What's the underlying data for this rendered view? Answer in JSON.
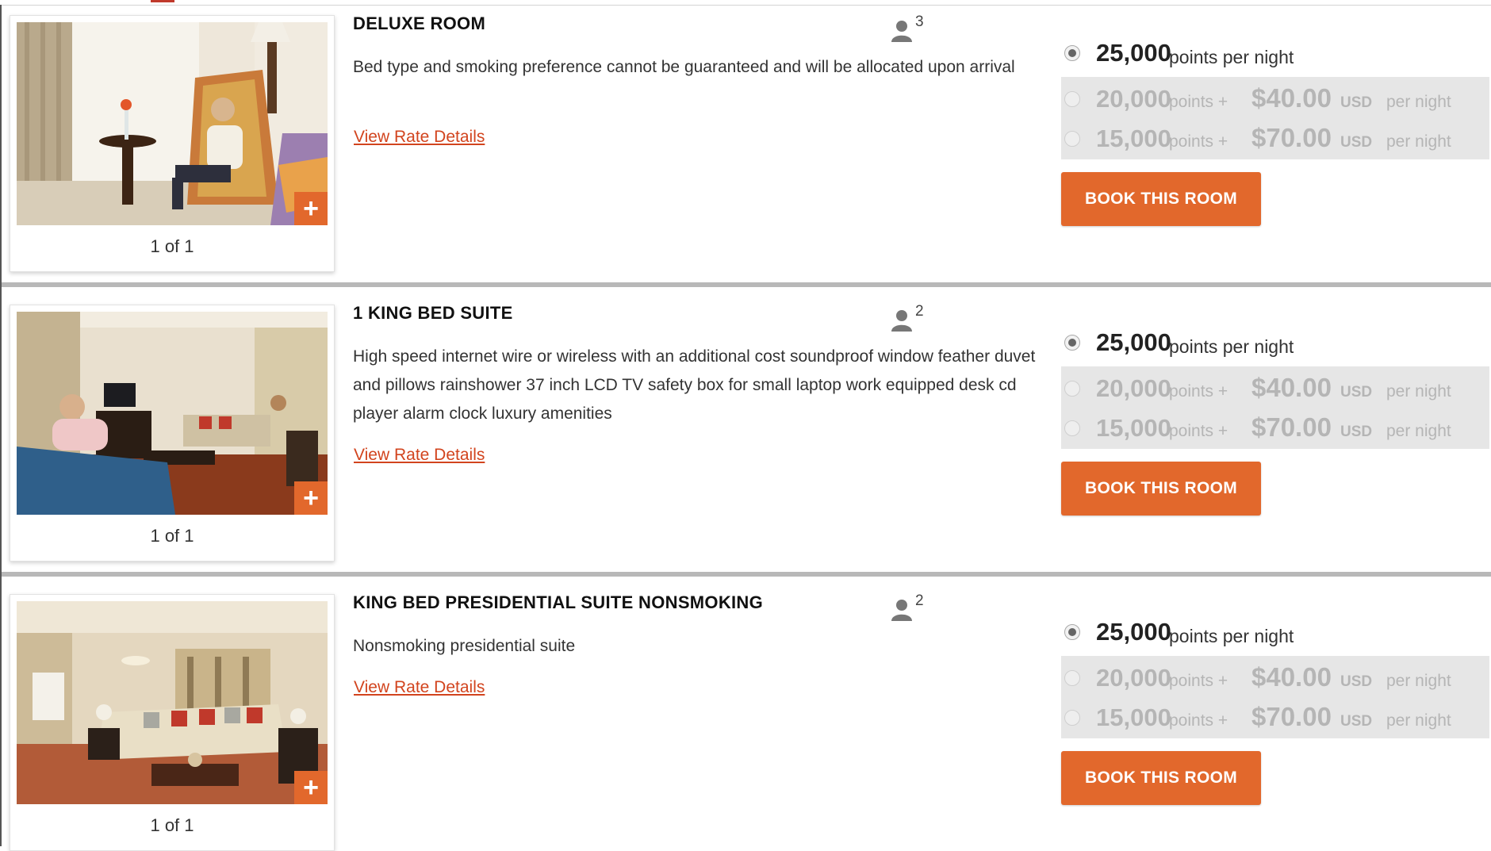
{
  "colors": {
    "accent": "#e2682c",
    "link": "#d2441e",
    "alt_rates_bg": "#e6e6e6",
    "divider": "#b8b8b8"
  },
  "rooms": [
    {
      "title": "DELUXE ROOM",
      "occupancy": "3",
      "description": "Bed type and smoking preference cannot be guaranteed and will be allocated upon arrival",
      "rate_link": "View Rate Details",
      "photo_counter": "1 of 1",
      "photo_button": "+",
      "main_rate": {
        "points": "25,000",
        "suffix": "points per night",
        "selected": true
      },
      "alt_rates": [
        {
          "points": "20,000",
          "points_label": "points +",
          "cash": "$40.00",
          "currency": "USD",
          "per": "per night"
        },
        {
          "points": "15,000",
          "points_label": "points +",
          "cash": "$70.00",
          "currency": "USD",
          "per": "per night"
        }
      ],
      "book_label": "BOOK THIS ROOM"
    },
    {
      "title": "1 KING BED SUITE",
      "occupancy": "2",
      "description": "High speed internet wire or wireless with an additional cost soundproof window feather duvet and pillows rainshower 37 inch LCD TV safety box for small laptop work equipped desk cd player alarm clock luxury amenities",
      "rate_link": "View Rate Details",
      "photo_counter": "1 of 1",
      "photo_button": "+",
      "main_rate": {
        "points": "25,000",
        "suffix": "points per night",
        "selected": true
      },
      "alt_rates": [
        {
          "points": "20,000",
          "points_label": "points +",
          "cash": "$40.00",
          "currency": "USD",
          "per": "per night"
        },
        {
          "points": "15,000",
          "points_label": "points +",
          "cash": "$70.00",
          "currency": "USD",
          "per": "per night"
        }
      ],
      "book_label": "BOOK THIS ROOM"
    },
    {
      "title": "KING BED PRESIDENTIAL SUITE NONSMOKING",
      "occupancy": "2",
      "description": "Nonsmoking presidential suite",
      "rate_link": "View Rate Details",
      "photo_counter": "1 of 1",
      "photo_button": "+",
      "main_rate": {
        "points": "25,000",
        "suffix": "points per night",
        "selected": true
      },
      "alt_rates": [
        {
          "points": "20,000",
          "points_label": "points +",
          "cash": "$40.00",
          "currency": "USD",
          "per": "per night"
        },
        {
          "points": "15,000",
          "points_label": "points +",
          "cash": "$70.00",
          "currency": "USD",
          "per": "per night"
        }
      ],
      "book_label": "BOOK THIS ROOM"
    }
  ]
}
